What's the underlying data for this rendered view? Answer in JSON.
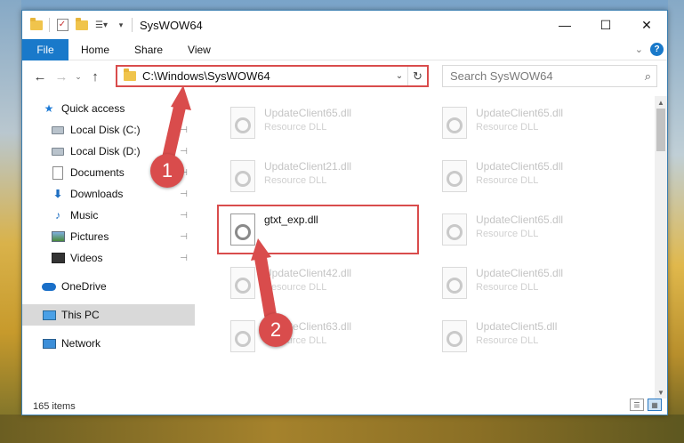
{
  "window": {
    "title": "SysWOW64",
    "controls": {
      "minimize": "—",
      "maximize": "☐",
      "close": "✕"
    }
  },
  "ribbon": {
    "tabs": [
      "File",
      "Home",
      "Share",
      "View"
    ],
    "expand_icon": "⌄",
    "help_icon": "?"
  },
  "navigation": {
    "back": "←",
    "forward": "→",
    "recent": "⌄",
    "up": "↑"
  },
  "address_bar": {
    "path": "C:\\Windows\\SysWOW64",
    "dropdown": "⌄",
    "refresh": "↻"
  },
  "search": {
    "placeholder": "Search SysWOW64",
    "icon": "⌕"
  },
  "nav_pane": {
    "items": [
      {
        "label": "Quick access",
        "icon": "star-icon",
        "pinned": false
      },
      {
        "label": "Local Disk (C:)",
        "icon": "drive-icon",
        "pinned": true
      },
      {
        "label": "Local Disk (D:)",
        "icon": "drive-icon",
        "pinned": true
      },
      {
        "label": "Documents",
        "icon": "documents-icon",
        "pinned": true
      },
      {
        "label": "Downloads",
        "icon": "downloads-icon",
        "pinned": true
      },
      {
        "label": "Music",
        "icon": "music-icon",
        "pinned": true
      },
      {
        "label": "Pictures",
        "icon": "pictures-icon",
        "pinned": true
      },
      {
        "label": "Videos",
        "icon": "videos-icon",
        "pinned": true
      },
      {
        "label": "OneDrive",
        "icon": "onedrive-icon",
        "pinned": false
      },
      {
        "label": "This PC",
        "icon": "this-pc-icon",
        "pinned": false,
        "selected": true
      },
      {
        "label": "Network",
        "icon": "network-icon",
        "pinned": false
      }
    ],
    "pin_glyph": "📌"
  },
  "files": {
    "left_column": [
      {
        "name": "UpdateClient65.dll",
        "type": "Resource DLL"
      },
      {
        "name": "UpdateClient21.dll",
        "type": "Resource DLL"
      },
      {
        "name": "gtxt_exp.dll",
        "type": ""
      },
      {
        "name": "UpdateClient42.dll",
        "type": "Resource DLL"
      },
      {
        "name": "UpdateClient63.dll",
        "type": "Resource DLL"
      }
    ],
    "right_column": [
      {
        "name": "UpdateClient65.dll",
        "type": "Resource DLL"
      },
      {
        "name": "UpdateClient65.dll",
        "type": "Resource DLL"
      },
      {
        "name": "UpdateClient65.dll",
        "type": "Resource DLL"
      },
      {
        "name": "UpdateClient65.dll",
        "type": "Resource DLL"
      },
      {
        "name": "UpdateClient5.dll",
        "type": "Resource DLL"
      }
    ]
  },
  "status_bar": {
    "item_count": "165 items"
  },
  "annotations": {
    "step1": "1",
    "step2": "2",
    "color": "#d94c4c"
  }
}
